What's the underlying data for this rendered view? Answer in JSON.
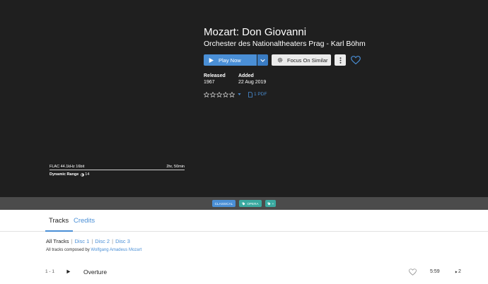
{
  "album": {
    "title": "Mozart: Don Giovanni",
    "artists": "Orchester des Nationaltheaters Prag  -  Karl Böhm",
    "released_label": "Released",
    "released_value": "1967",
    "added_label": "Added",
    "added_value": "22 Aug 2019"
  },
  "actions": {
    "play_label": "Play Now",
    "focus_label": "Focus On Similar"
  },
  "rating": {
    "stars": 5,
    "filled": 0
  },
  "pdf_label": "1 PDF",
  "tech": {
    "format": "FLAC 44.1kHz 16bit",
    "duration": "2hr, 50min",
    "dr_label": "Dynamic Range",
    "dr_value": "14"
  },
  "tags": [
    {
      "label": "CLASSICAL",
      "color": "#4a8fd6"
    },
    {
      "label": "OPERA",
      "color": "#3aa9a0"
    },
    {
      "label": "+",
      "color": "#3aa9a0"
    }
  ],
  "tabs": {
    "tracks": "Tracks",
    "credits": "Credits"
  },
  "discs": {
    "all": "All Tracks",
    "disc1": "Disc 1",
    "disc2": "Disc 2",
    "disc3": "Disc 3",
    "sep": "|"
  },
  "composed": {
    "prefix": "All tracks composed by",
    "composer": "Wolfgang Amadeus Mozart"
  },
  "tracks": [
    {
      "num": "1 - 1",
      "title": "Overture",
      "duration": "5:59",
      "plays": "2"
    }
  ],
  "colors": {
    "accent": "#4a8fd6",
    "hero_bg": "#1f1f1f",
    "tagbar_bg": "#4b4b4b",
    "teal": "#3aa9a0"
  }
}
